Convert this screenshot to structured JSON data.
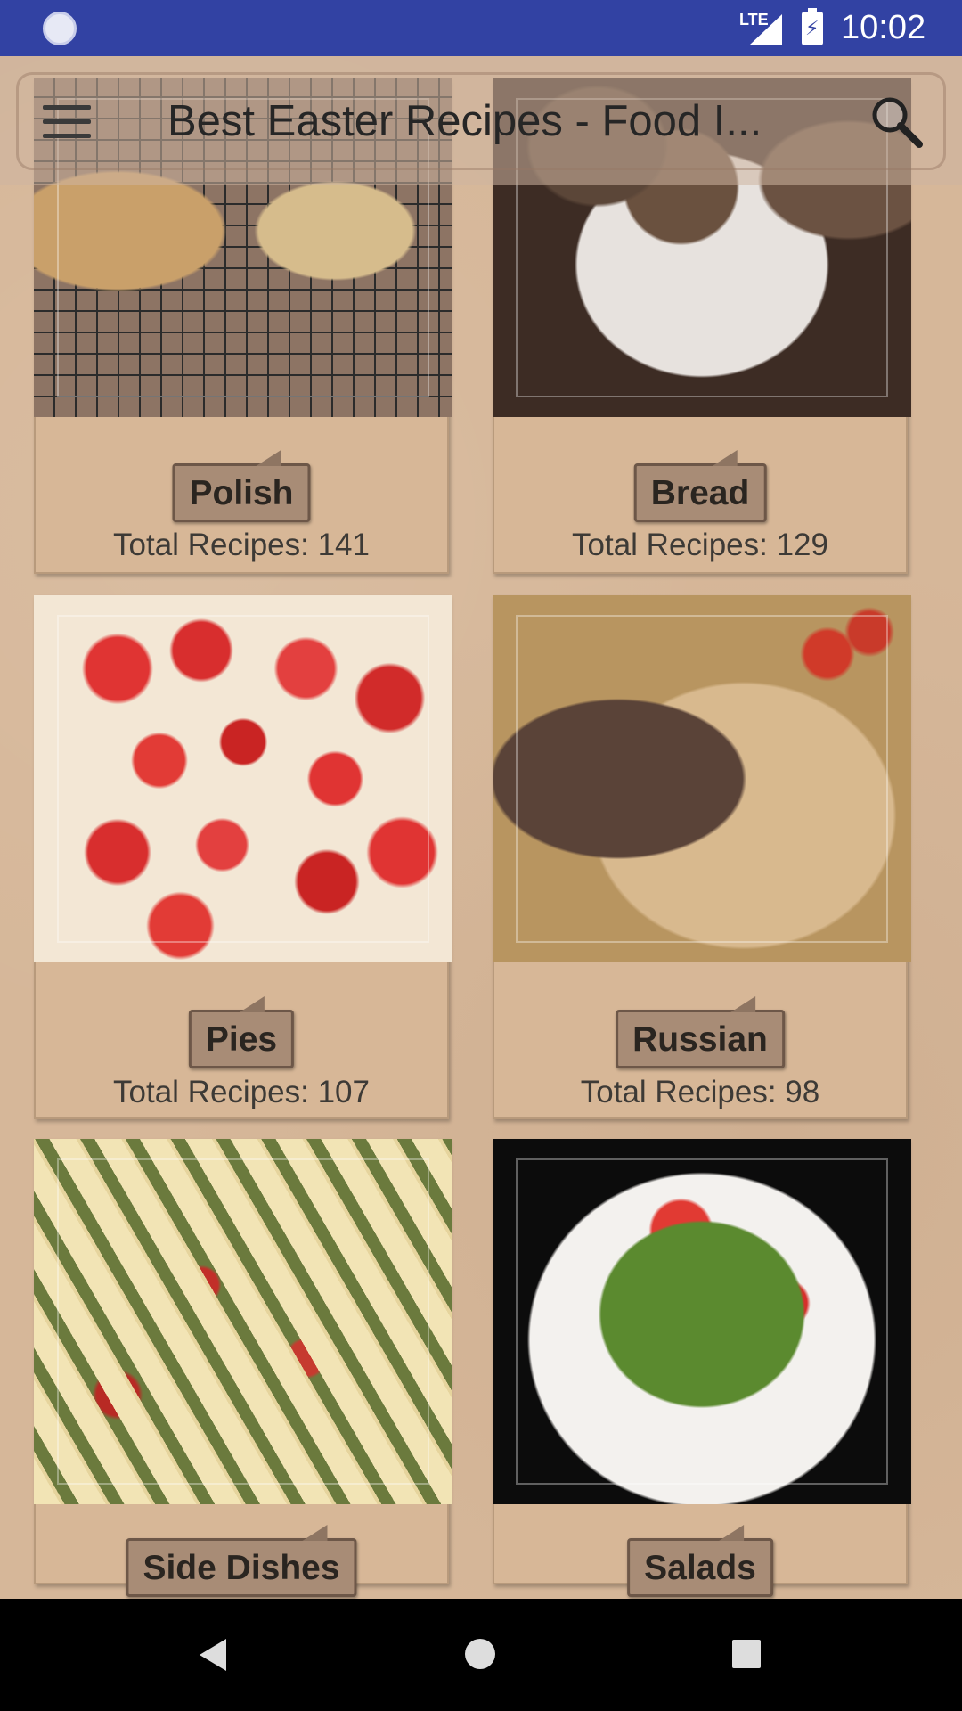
{
  "status_bar": {
    "network": "LTE",
    "battery_symbol": "⚡",
    "time": "10:02"
  },
  "toolbar": {
    "title": "Best Easter Recipes - Food I...",
    "menu_icon": "hamburger-menu-icon",
    "search_icon": "search-icon"
  },
  "categories": [
    {
      "label": "Polish",
      "count_text": "Total Recipes: 141",
      "image": "braided-bread-on-rack"
    },
    {
      "label": "Bread",
      "count_text": "Total Recipes: 129",
      "image": "muffins-on-plate"
    },
    {
      "label": "Pies",
      "count_text": "Total Recipes: 107",
      "image": "strawberry-tart"
    },
    {
      "label": "Russian",
      "count_text": "Total Recipes: 98",
      "image": "sliced-rye-bread"
    },
    {
      "label": "Side Dishes",
      "count_text": "",
      "image": "penne-pasta"
    },
    {
      "label": "Salads",
      "count_text": "",
      "image": "strawberry-salad"
    }
  ],
  "navigation": {
    "back": "back-icon",
    "home": "home-icon",
    "recents": "recents-icon"
  },
  "colors": {
    "status_bar": "#3242a3",
    "background": "#d6b799",
    "label_button": "#a88c76",
    "nav_bar": "#000000"
  }
}
